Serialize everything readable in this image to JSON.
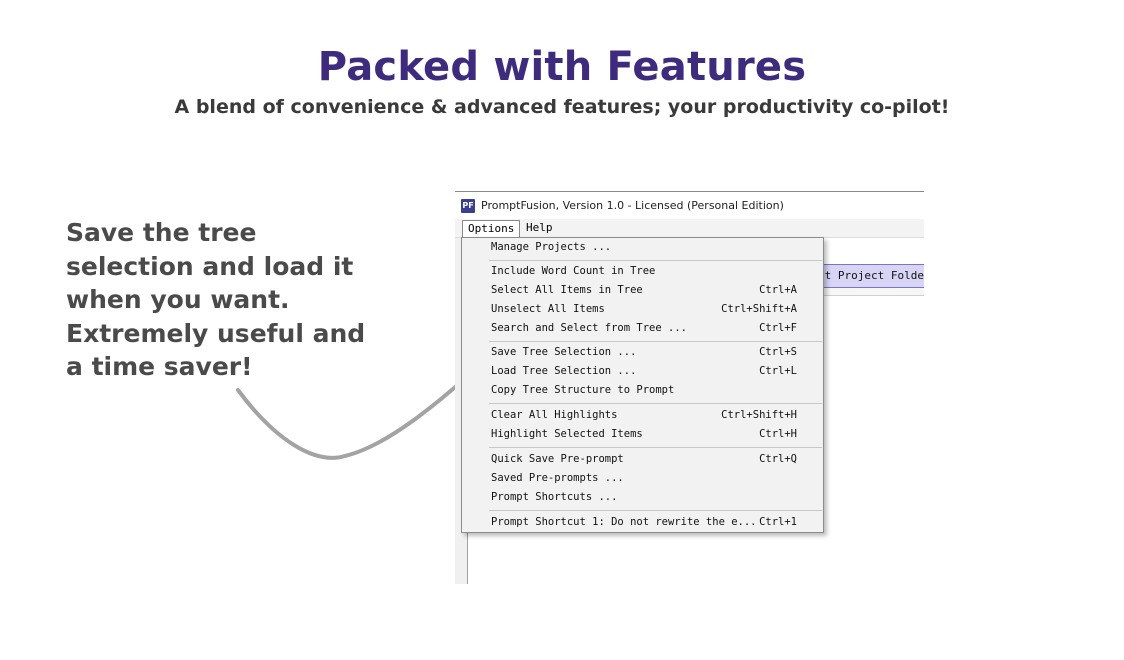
{
  "heading": {
    "title": "Packed with Features",
    "subtitle": "A blend of convenience & advanced features; your productivity co-pilot!"
  },
  "callout": {
    "lines": [
      "Save the tree",
      "selection and load it",
      "when you want.",
      "Extremely useful and",
      "a time saver!"
    ]
  },
  "app": {
    "logo_text": "PF",
    "window_title": "PromptFusion, Version 1.0 - Licensed (Personal Edition)",
    "menubar": {
      "options": "Options",
      "help": "Help"
    },
    "background_button": "ct Project Folder",
    "dropdown": [
      {
        "label": "Manage Projects ...",
        "shortcut": ""
      },
      {
        "label": "Include Word Count in Tree",
        "shortcut": ""
      },
      {
        "label": "Select All Items in Tree",
        "shortcut": "Ctrl+A"
      },
      {
        "label": "Unselect All Items",
        "shortcut": "Ctrl+Shift+A"
      },
      {
        "label": "Search and Select from Tree ...",
        "shortcut": "Ctrl+F"
      },
      {
        "label": "Save Tree Selection ...",
        "shortcut": "Ctrl+S"
      },
      {
        "label": "Load Tree Selection ...",
        "shortcut": "Ctrl+L"
      },
      {
        "label": "Copy Tree Structure to Prompt",
        "shortcut": ""
      },
      {
        "label": "Clear All Highlights",
        "shortcut": "Ctrl+Shift+H"
      },
      {
        "label": "Highlight Selected Items",
        "shortcut": "Ctrl+H"
      },
      {
        "label": "Quick Save Pre-prompt",
        "shortcut": "Ctrl+Q"
      },
      {
        "label": "Saved Pre-prompts ...",
        "shortcut": ""
      },
      {
        "label": "Prompt Shortcuts ...",
        "shortcut": ""
      },
      {
        "label": "Prompt Shortcut 1: Do not rewrite the e...",
        "shortcut": "Ctrl+1"
      }
    ]
  },
  "colors": {
    "title": "#3f2b7e",
    "callout_text": "#4a4a4a",
    "arrow": "#a3a3a3",
    "button_fill": "#d7d4f6"
  },
  "icons": {
    "arrow": "curved-arrow-icon",
    "app_logo": "promptfusion-logo-icon"
  }
}
